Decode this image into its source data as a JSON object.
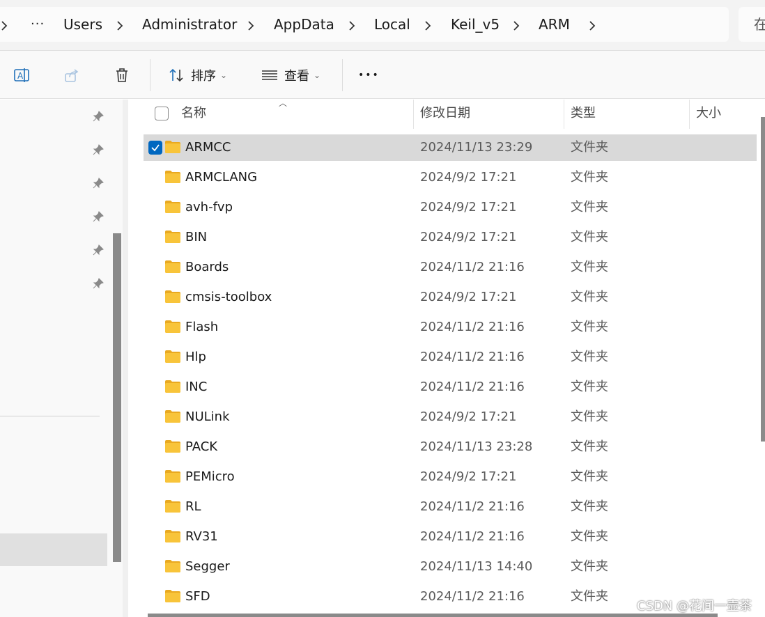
{
  "address_bar": {
    "crumbs": [
      "Users",
      "Administrator",
      "AppData",
      "Local",
      "Keil_v5",
      "ARM"
    ],
    "overflow": "···",
    "search_placeholder": "在"
  },
  "command_bar": {
    "sort_label": "排序",
    "view_label": "查看",
    "more_label": "•••"
  },
  "columns": {
    "name": "名称",
    "modified": "修改日期",
    "type": "类型",
    "size": "大小"
  },
  "files": [
    {
      "name": "ARMCC",
      "modified": "2024/11/13 23:29",
      "type": "文件夹",
      "selected": true
    },
    {
      "name": "ARMCLANG",
      "modified": "2024/9/2 17:21",
      "type": "文件夹"
    },
    {
      "name": "avh-fvp",
      "modified": "2024/9/2 17:21",
      "type": "文件夹"
    },
    {
      "name": "BIN",
      "modified": "2024/9/2 17:21",
      "type": "文件夹"
    },
    {
      "name": "Boards",
      "modified": "2024/11/2 21:16",
      "type": "文件夹"
    },
    {
      "name": "cmsis-toolbox",
      "modified": "2024/9/2 17:21",
      "type": "文件夹"
    },
    {
      "name": "Flash",
      "modified": "2024/11/2 21:16",
      "type": "文件夹"
    },
    {
      "name": "Hlp",
      "modified": "2024/11/2 21:16",
      "type": "文件夹"
    },
    {
      "name": "INC",
      "modified": "2024/11/2 21:16",
      "type": "文件夹"
    },
    {
      "name": "NULink",
      "modified": "2024/9/2 17:21",
      "type": "文件夹"
    },
    {
      "name": "PACK",
      "modified": "2024/11/13 23:28",
      "type": "文件夹"
    },
    {
      "name": "PEMicro",
      "modified": "2024/9/2 17:21",
      "type": "文件夹"
    },
    {
      "name": "RL",
      "modified": "2024/11/2 21:16",
      "type": "文件夹"
    },
    {
      "name": "RV31",
      "modified": "2024/11/2 21:16",
      "type": "文件夹"
    },
    {
      "name": "Segger",
      "modified": "2024/11/13 14:40",
      "type": "文件夹"
    },
    {
      "name": "SFD",
      "modified": "2024/11/2 21:16",
      "type": "文件夹"
    }
  ],
  "watermark": "CSDN @花间一壶茶",
  "colors": {
    "accent": "#0067c0",
    "folder": "#f8c43a",
    "selected_row": "#d9d9d9"
  }
}
